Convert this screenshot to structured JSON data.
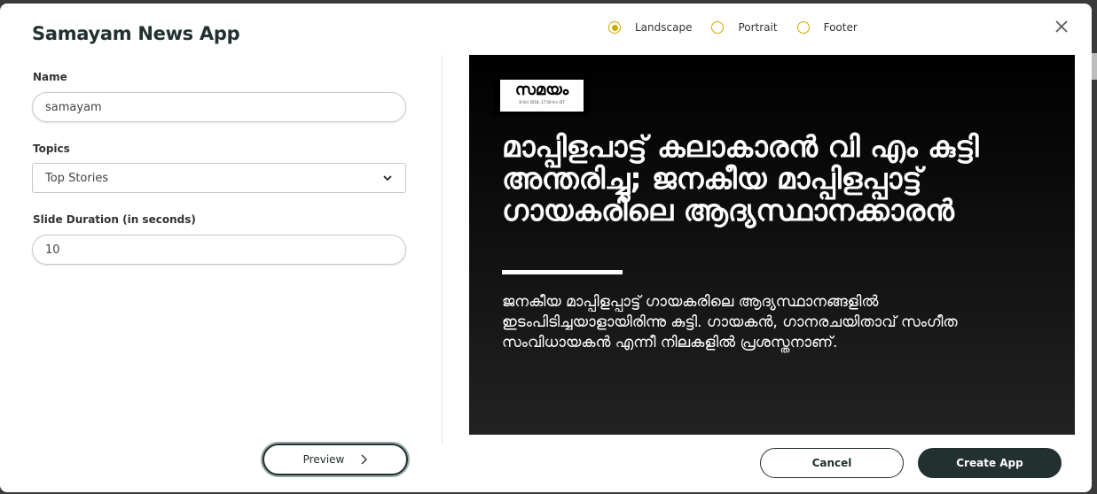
{
  "modal": {
    "title": "Samayam News App",
    "close_label": "×"
  },
  "layout_options": [
    {
      "label": "Landscape",
      "selected": true
    },
    {
      "label": "Portrait",
      "selected": false
    },
    {
      "label": "Footer",
      "selected": false
    }
  ],
  "form": {
    "name_label": "Name",
    "name_value": "samayam",
    "topics_label": "Topics",
    "topics_value": "Top Stories",
    "duration_label": "Slide Duration (in seconds)",
    "duration_value": "10"
  },
  "preview": {
    "logo_text": "സമയം",
    "logo_date": "8 Oct 2018, 17:58 hrs IST",
    "headline": "മാപ്പിളപാട്ട് കലാകാരൻ വി എം കുട്ടി അന്തരിച്ചു; ജനകീയ മാപ്പിളപ്പാട്ട് ഗായകരിലെ ആദ്യസ്ഥാനക്കാരൻ",
    "summary": "ജനകീയ മാപ്പിളപ്പാട്ട് ഗായകരിലെ ആദ്യസ്ഥാനങ്ങളിൽ ഇടംപിടിച്ചയാളായിരിന്നു കുട്ടി. ഗായകൻ, ഗാനരചയിതാവ് സംഗീത സംവിധായകൻ എന്നീ നിലകളിൽ പ്രശസ്തനാണ്."
  },
  "buttons": {
    "preview_label": "Preview",
    "cancel_label": "Cancel",
    "create_label": "Create App"
  },
  "colors": {
    "accent": "#d4a800",
    "primary_dark": "#22302f"
  }
}
